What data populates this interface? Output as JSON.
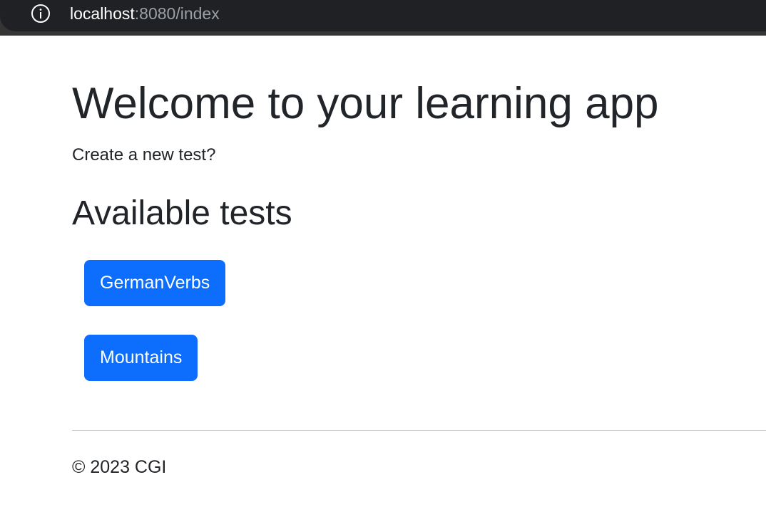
{
  "browser": {
    "url_host": "localhost",
    "url_rest": ":8080/index",
    "info_icon": "info-icon"
  },
  "main": {
    "title": "Welcome to your learning app",
    "create_link": "Create a new test?",
    "section_title": "Available tests",
    "tests": [
      {
        "label": "GermanVerbs"
      },
      {
        "label": "Mountains"
      }
    ]
  },
  "footer": {
    "text": "© 2023 CGI"
  },
  "colors": {
    "button_primary": "#0d6efd",
    "text": "#212529",
    "browser_bar": "#202124"
  }
}
